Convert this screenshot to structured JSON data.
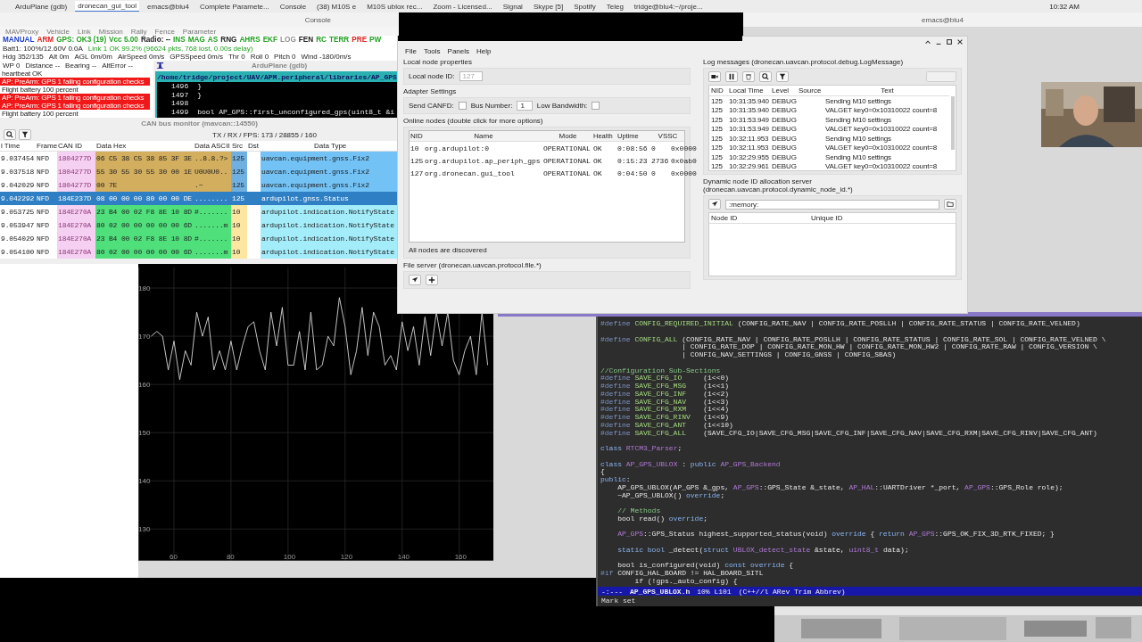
{
  "taskbar": {
    "tasks": [
      {
        "label": "ArduPlane (gdb)",
        "selected": false
      },
      {
        "label": "dronecan_gui_tool",
        "selected": true
      },
      {
        "label": "emacs@blu4",
        "selected": false
      },
      {
        "label": "Complete Paramete...",
        "selected": false
      },
      {
        "label": "Console",
        "selected": false
      },
      {
        "label": "(38) M10S e",
        "selected": false
      },
      {
        "label": "M10S ublox rec...",
        "selected": false
      },
      {
        "label": "Zoom - Licensed...",
        "selected": false
      },
      {
        "label": "Signal",
        "selected": false
      },
      {
        "label": "Skype [5]",
        "selected": false
      },
      {
        "label": "Spotify",
        "selected": false
      },
      {
        "label": "Teleg",
        "selected": false
      },
      {
        "label": "tridge@blu4:~/proje...",
        "selected": false
      }
    ],
    "clock": "10:32 AM"
  },
  "console_title": "Console",
  "emacs_title": "emacs@blu4",
  "mavproxy": {
    "menu": [
      "MAVProxy",
      "Vehicle",
      "Link",
      "Mission",
      "Rally",
      "Fence",
      "Parameter"
    ],
    "status_row": [
      {
        "text": "MANUAL",
        "color": "#1a3cc8"
      },
      {
        "text": "ARM",
        "color": "#e02020"
      },
      {
        "text": "GPS: OK3 (19)",
        "color": "#20a020"
      },
      {
        "text": "Vcc 5.00",
        "color": "#20a020"
      },
      {
        "text": "Radio: --",
        "color": "#202020"
      },
      {
        "text": "INS",
        "color": "#20a020"
      },
      {
        "text": "MAG",
        "color": "#20a020"
      },
      {
        "text": "AS",
        "color": "#20a020"
      },
      {
        "text": "RNG",
        "color": "#202020"
      },
      {
        "text": "AHRS",
        "color": "#20a020"
      },
      {
        "text": "EKF",
        "color": "#20a020"
      },
      {
        "text": "LOG",
        "color": "#909090"
      },
      {
        "text": "FEN",
        "color": "#202020"
      },
      {
        "text": "RC",
        "color": "#20a020"
      },
      {
        "text": "TERR",
        "color": "#20a020"
      },
      {
        "text": "PRE",
        "color": "#e02020"
      },
      {
        "text": "PW",
        "color": "#20a020"
      }
    ],
    "battery": "Batt1: 100%/12.60V 0.0A",
    "link": "Link 1 OK 99.2% (96624 pkts, 768 lost, 0.00s delay)",
    "flight_row": [
      "Hdg 352/135",
      "Alt 0m",
      "AGL 0m/0m",
      "AirSpeed 0m/s",
      "GPSSpeed 0m/s",
      "Thr 0",
      "Roll 0",
      "Pitch 0",
      "Wind -180/0m/s"
    ],
    "nav_row": [
      "WP 0",
      "Distance --",
      "Bearing --",
      "AltError --"
    ],
    "messages": [
      {
        "text": "heartbeat OK",
        "kind": "info"
      },
      {
        "text": "AP: PreArm: GPS 1 failing configuration checks",
        "kind": "error"
      },
      {
        "text": "Flight battery 100 percent",
        "kind": "info"
      },
      {
        "text": "AP: PreArm: GPS 1 failing configuration checks",
        "kind": "error"
      },
      {
        "text": "AP: PreArm: GPS 1 failing configuration checks",
        "kind": "error"
      },
      {
        "text": "Flight battery 100 percent",
        "kind": "info"
      }
    ]
  },
  "gdb": {
    "title": "ArduPlane (gdb)",
    "path": "/home/tridge/project/UAV/APM.peripheral/libraries/AP_GPS",
    "lines": [
      {
        "number": "1496",
        "code": "}"
      },
      {
        "number": "1497",
        "code": "}"
      },
      {
        "number": "1498"
      },
      {
        "number": "1499",
        "code": "bool AP_GPS::first_unconfigured_gps(uint8_t &i"
      }
    ]
  },
  "can_monitor": {
    "title": "CAN bus monitor (mavcan::14550)",
    "stats": "TX / RX / FPS:  173 / 28855 / 160",
    "columns": [
      "l Time",
      "Frame",
      "CAN ID",
      "Data Hex",
      "Data ASCII",
      "Src",
      "Dst",
      "Data Type"
    ],
    "rows": [
      {
        "time": "9.037454",
        "frame": "NFD",
        "can_id": "1804277D",
        "hex": {
          "text": "06 C5 38 C5 38 85 3F 3E",
          "color": "#d2ae5e"
        },
        "ascii": {
          "text": "..8.8.?>",
          "color": "#d2ae5e"
        },
        "src": {
          "text": "125",
          "color": "#6fb0e0"
        },
        "type": {
          "text": "uavcan.equipment.gnss.Fix2",
          "color": "#72c2f5"
        },
        "selected": false
      },
      {
        "time": "9.037518",
        "frame": "NFD",
        "can_id": "1804277D",
        "hex": {
          "text": "55 30 55 30 55 30 00 1E",
          "color": "#d2ae5e"
        },
        "ascii": {
          "text": "U0U0U0..",
          "color": "#d2ae5e"
        },
        "src": {
          "text": "125",
          "color": "#6fb0e0"
        },
        "type": {
          "text": "uavcan.equipment.gnss.Fix2",
          "color": "#72c2f5"
        },
        "selected": false
      },
      {
        "time": "9.042029",
        "frame": "NFD",
        "can_id": "1804277D",
        "hex": {
          "text": "00 7E",
          "color": "#d2ae5e"
        },
        "ascii": {
          "text": ".~",
          "color": "#d2ae5e"
        },
        "src": {
          "text": "125",
          "color": "#6fb0e0"
        },
        "type": {
          "text": "uavcan.equipment.gnss.Fix2",
          "color": "#72c2f5"
        },
        "selected": false
      },
      {
        "time": "9.042292",
        "frame": "NFD",
        "can_id": "184E237D",
        "hex": {
          "text": "08 00 00 00 80 00 00 DE"
        },
        "ascii": {
          "text": "........"
        },
        "src": {
          "text": "125"
        },
        "type": {
          "text": "ardupilot.gnss.Status"
        },
        "selected": true
      },
      {
        "time": "9.053725",
        "frame": "NFD",
        "can_id": "184E270A",
        "hex": {
          "text": "23 B4 00 02 F8 8E 10 8D",
          "color": "#4fe07c"
        },
        "ascii": {
          "text": "#.......",
          "color": "#4fe07c"
        },
        "src": {
          "text": "10",
          "color": "#fde6a0"
        },
        "type": {
          "text": "ardupilot.indication.NotifyState",
          "color": "#a3ecfa"
        },
        "selected": false
      },
      {
        "time": "9.053947",
        "frame": "NFD",
        "can_id": "184E270A",
        "hex": {
          "text": "80 02 00 00 00 00 00 6D",
          "color": "#4fe07c"
        },
        "ascii": {
          "text": ".......m",
          "color": "#4fe07c"
        },
        "src": {
          "text": "10",
          "color": "#fde6a0"
        },
        "type": {
          "text": "ardupilot.indication.NotifyState",
          "color": "#a3ecfa"
        },
        "selected": false
      },
      {
        "time": "9.054029",
        "frame": "NFD",
        "can_id": "184E270A",
        "hex": {
          "text": "23 B4 00 02 F8 8E 10 8D",
          "color": "#4fe07c"
        },
        "ascii": {
          "text": "#.......",
          "color": "#4fe07c"
        },
        "src": {
          "text": "10",
          "color": "#fde6a0"
        },
        "type": {
          "text": "ardupilot.indication.NotifyState",
          "color": "#a3ecfa"
        },
        "selected": false
      },
      {
        "time": "9.054100",
        "frame": "NFD",
        "can_id": "184E270A",
        "hex": {
          "text": "80 02 00 00 00 00 00 6D",
          "color": "#4fe07c"
        },
        "ascii": {
          "text": ".......m",
          "color": "#4fe07c"
        },
        "src": {
          "text": "10",
          "color": "#fde6a0"
        },
        "type": {
          "text": "ardupilot.indication.NotifyState",
          "color": "#a3ecfa"
        },
        "selected": false
      }
    ]
  },
  "plot": {
    "chart_data": {
      "type": "line",
      "grid": true,
      "xlim": [
        47.5,
        172
      ],
      "ylim": [
        123.4,
        185
      ],
      "xticks": [
        60,
        80,
        100,
        120,
        140,
        160
      ],
      "yticks": [
        180,
        170,
        160,
        150,
        140,
        130
      ],
      "x": [
        52,
        54,
        56,
        58,
        60,
        62,
        64,
        66,
        68,
        70,
        72,
        74,
        76,
        78,
        80,
        82,
        84,
        86,
        88,
        90,
        92,
        94,
        96,
        98,
        100,
        102,
        104,
        106,
        108,
        110,
        112,
        114,
        116,
        118,
        120,
        122,
        124,
        126,
        128,
        130,
        132,
        134,
        136,
        138,
        140,
        142,
        144,
        146,
        148,
        150,
        152,
        154,
        156,
        158,
        160,
        162,
        164,
        166,
        168,
        170
      ],
      "series": [
        {
          "color": "#d8d8d8",
          "values": [
            170,
            171,
            170,
            163,
            169,
            161,
            167,
            164,
            175,
            170,
            174,
            163,
            167,
            163,
            169,
            163,
            168,
            172,
            173,
            167,
            163,
            175,
            168,
            176,
            164,
            164,
            171,
            163,
            175,
            163,
            164,
            170,
            168,
            178,
            172,
            162,
            167,
            176,
            166,
            175,
            172,
            164,
            166,
            163,
            173,
            167,
            172,
            164,
            174,
            166,
            175,
            168,
            175,
            165,
            162,
            167,
            170,
            162,
            175,
            164
          ]
        }
      ]
    }
  },
  "gui_tool": {
    "menu": [
      "File",
      "Tools",
      "Panels",
      "Help"
    ],
    "local_node": {
      "heading": "Local node properties",
      "label": "Local node ID:",
      "value": "127"
    },
    "adapter": {
      "heading": "Adapter Settings",
      "canfd_label": "Send CANFD:",
      "canfd": false,
      "bus_label": "Bus Number:",
      "bus": "1",
      "bandwidth_label": "Low Bandwidth:",
      "low_bandwidth": false
    },
    "nodes": {
      "heading": "Online nodes (double click for more options)",
      "columns": [
        "NID",
        "Name",
        "Mode",
        "Health",
        "Uptime",
        "VSSC"
      ],
      "rows": [
        {
          "nid": "10",
          "name": "org.ardupilot:0",
          "mode": "OPERATIONAL",
          "health": "OK",
          "uptime": "0:08:56",
          "vssc": "0",
          "vssc_hex": "0x0000"
        },
        {
          "nid": "125",
          "name": "org.ardupilot.ap_periph_gps",
          "mode": "OPERATIONAL",
          "health": "OK",
          "uptime": "0:15:23",
          "vssc": "2736",
          "vssc_hex": "0x0ab0"
        },
        {
          "nid": "127",
          "name": "org.dronecan.gui_tool",
          "mode": "OPERATIONAL",
          "health": "OK",
          "uptime": "0:04:50",
          "vssc": "0",
          "vssc_hex": "0x0000"
        }
      ],
      "status": "All nodes are discovered"
    },
    "file_server": {
      "heading": "File server (dronecan.uavcan.protocol.file.*)"
    },
    "log": {
      "heading": "Log messages (dronecan.uavcan.protocol.debug.LogMessage)",
      "columns": [
        "NID",
        "Local Time",
        "Level",
        "Source",
        "Text"
      ],
      "rows": [
        {
          "nid": "125",
          "time": "10:31:35.940",
          "level": "DEBUG",
          "text": "Sending M10 settings"
        },
        {
          "nid": "125",
          "time": "10:31:35.940",
          "level": "DEBUG",
          "text": "VALGET key0=0x10310022 count=8"
        },
        {
          "nid": "125",
          "time": "10:31:53.949",
          "level": "DEBUG",
          "text": "Sending M10 settings"
        },
        {
          "nid": "125",
          "time": "10:31:53.949",
          "level": "DEBUG",
          "text": "VALGET key0=0x10310022 count=8"
        },
        {
          "nid": "125",
          "time": "10:32:11.953",
          "level": "DEBUG",
          "text": "Sending M10 settings"
        },
        {
          "nid": "125",
          "time": "10:32:11.953",
          "level": "DEBUG",
          "text": "VALGET key0=0x10310022 count=8"
        },
        {
          "nid": "125",
          "time": "10:32:29.955",
          "level": "DEBUG",
          "text": "Sending M10 settings"
        },
        {
          "nid": "125",
          "time": "10:32:29.961",
          "level": "DEBUG",
          "text": "VALGET key0=0x10310022 count=8"
        }
      ]
    },
    "allocator": {
      "heading": "Dynamic node ID allocation server (dronecan.uavcan.protocol.dynamic_node_id.*)",
      "database": ":memory:",
      "columns": [
        "Node ID",
        "Unique ID"
      ]
    }
  },
  "emacs": {
    "blocks": [
      {
        "lines": [
          {
            "segments": [
              {
                "text": "#define",
                "kind": "pre"
              },
              {
                "text": " CONFIG_REQUIRED_INITIAL",
                "kind": "macro"
              },
              {
                "text": " (CONFIG_RATE_NAV | CONFIG_RATE_POSLLH | CONFIG_RATE_STATUS | CONFIG_RATE_VELNED)",
                "kind": "plain"
              }
            ]
          }
        ]
      },
      {
        "lines": [
          {
            "segments": [
              {
                "text": "#define",
                "kind": "pre"
              },
              {
                "text": " CONFIG_ALL",
                "kind": "macro"
              },
              {
                "text": " (CONFIG_RATE_NAV | CONFIG_RATE_POSLLH | CONFIG_RATE_STATUS | CONFIG_RATE_SOL | CONFIG_RATE_VELNED \\",
                "kind": "plain"
              }
            ]
          },
          {
            "segments": [
              {
                "text": "                   | CONFIG_RATE_DOP | CONFIG_RATE_MON_HW | CONFIG_RATE_MON_HW2 | CONFIG_RATE_RAW | CONFIG_VERSION \\",
                "kind": "plain"
              }
            ]
          },
          {
            "segments": [
              {
                "text": "                   | CONFIG_NAV_SETTINGS | CONFIG_GNSS | CONFIG_SBAS)",
                "kind": "plain"
              }
            ]
          }
        ]
      },
      {
        "lines": [
          {
            "segments": [
              {
                "text": "//Configuration Sub-Sections",
                "kind": "comment"
              }
            ]
          },
          {
            "segments": [
              {
                "text": "#define",
                "kind": "pre"
              },
              {
                "text": " SAVE_CFG_IO",
                "kind": "macro"
              },
              {
                "text": "     (1<<0)",
                "kind": "plain"
              }
            ]
          },
          {
            "segments": [
              {
                "text": "#define",
                "kind": "pre"
              },
              {
                "text": " SAVE_CFG_MSG",
                "kind": "macro"
              },
              {
                "text": "    (1<<1)",
                "kind": "plain"
              }
            ]
          },
          {
            "segments": [
              {
                "text": "#define",
                "kind": "pre"
              },
              {
                "text": " SAVE_CFG_INF",
                "kind": "macro"
              },
              {
                "text": "    (1<<2)",
                "kind": "plain"
              }
            ]
          },
          {
            "segments": [
              {
                "text": "#define",
                "kind": "pre"
              },
              {
                "text": " SAVE_CFG_NAV",
                "kind": "macro"
              },
              {
                "text": "    (1<<3)",
                "kind": "plain"
              }
            ]
          },
          {
            "segments": [
              {
                "text": "#define",
                "kind": "pre"
              },
              {
                "text": " SAVE_CFG_RXM",
                "kind": "macro"
              },
              {
                "text": "    (1<<4)",
                "kind": "plain"
              }
            ]
          },
          {
            "segments": [
              {
                "text": "#define",
                "kind": "pre"
              },
              {
                "text": " SAVE_CFG_RINV",
                "kind": "macro"
              },
              {
                "text": "   (1<<9)",
                "kind": "plain"
              }
            ]
          },
          {
            "segments": [
              {
                "text": "#define",
                "kind": "pre"
              },
              {
                "text": " SAVE_CFG_ANT",
                "kind": "macro"
              },
              {
                "text": "    (1<<10)",
                "kind": "plain"
              }
            ]
          },
          {
            "segments": [
              {
                "text": "#define",
                "kind": "pre"
              },
              {
                "text": " SAVE_CFG_ALL",
                "kind": "macro"
              },
              {
                "text": "    (SAVE_CFG_IO|SAVE_CFG_MSG|SAVE_CFG_INF|SAVE_CFG_NAV|SAVE_CFG_RXM|SAVE_CFG_RINV|SAVE_CFG_ANT)",
                "kind": "plain"
              }
            ]
          }
        ]
      },
      {
        "lines": [
          {
            "segments": [
              {
                "text": "class",
                "kind": "keyword"
              },
              {
                "text": " RTCM3_Parser",
                "kind": "type"
              },
              {
                "text": ";",
                "kind": "plain"
              }
            ]
          }
        ]
      },
      {
        "lines": [
          {
            "segments": [
              {
                "text": "class",
                "kind": "keyword"
              },
              {
                "text": " AP_GPS_UBLOX",
                "kind": "type"
              },
              {
                "text": " : ",
                "kind": "plain"
              },
              {
                "text": "public",
                "kind": "keyword"
              },
              {
                "text": " AP_GPS_Backend",
                "kind": "type"
              }
            ]
          },
          {
            "segments": [
              {
                "text": "{",
                "kind": "plain"
              }
            ]
          },
          {
            "segments": [
              {
                "text": "public",
                "kind": "keyword"
              },
              {
                "text": ":",
                "kind": "plain"
              }
            ]
          },
          {
            "segments": [
              {
                "text": "    AP_GPS_UBLOX(AP_GPS &_gps, ",
                "kind": "plain"
              },
              {
                "text": "AP_GPS",
                "kind": "type"
              },
              {
                "text": "::GPS_State &_state, ",
                "kind": "plain"
              },
              {
                "text": "AP_HAL",
                "kind": "type"
              },
              {
                "text": "::UARTDriver *_port, ",
                "kind": "plain"
              },
              {
                "text": "AP_GPS",
                "kind": "type"
              },
              {
                "text": "::GPS_Role role);",
                "kind": "plain"
              }
            ]
          },
          {
            "segments": [
              {
                "text": "    ~AP_GPS_UBLOX() ",
                "kind": "plain"
              },
              {
                "text": "override",
                "kind": "keyword"
              },
              {
                "text": ";",
                "kind": "plain"
              }
            ]
          }
        ]
      },
      {
        "lines": [
          {
            "segments": [
              {
                "text": "    // Methods",
                "kind": "comment"
              }
            ]
          },
          {
            "segments": [
              {
                "text": "    bool read() ",
                "kind": "plain"
              },
              {
                "text": "override",
                "kind": "keyword"
              },
              {
                "text": ";",
                "kind": "plain"
              }
            ]
          }
        ]
      },
      {
        "lines": [
          {
            "segments": [
              {
                "text": "    AP_GPS",
                "kind": "type"
              },
              {
                "text": "::GPS_Status highest_supported_status(void) ",
                "kind": "plain"
              },
              {
                "text": "override",
                "kind": "keyword"
              },
              {
                "text": " { ",
                "kind": "plain"
              },
              {
                "text": "return",
                "kind": "keyword"
              },
              {
                "text": " AP_GPS",
                "kind": "type"
              },
              {
                "text": "::GPS_OK_FIX_3D_RTK_FIXED; }",
                "kind": "plain"
              }
            ]
          }
        ]
      },
      {
        "lines": [
          {
            "segments": [
              {
                "text": "    static bool",
                "kind": "keyword"
              },
              {
                "text": " _detect(",
                "kind": "plain"
              },
              {
                "text": "struct",
                "kind": "keyword"
              },
              {
                "text": " UBLOX_detect_state",
                "kind": "type"
              },
              {
                "text": " &state, ",
                "kind": "plain"
              },
              {
                "text": "uint8_t",
                "kind": "type"
              },
              {
                "text": " data);",
                "kind": "plain"
              }
            ]
          }
        ]
      },
      {
        "lines": [
          {
            "segments": [
              {
                "text": "    bool is_configured(void) ",
                "kind": "plain"
              },
              {
                "text": "const override",
                "kind": "keyword"
              },
              {
                "text": " {",
                "kind": "plain"
              }
            ]
          },
          {
            "segments": [
              {
                "text": "#if",
                "kind": "pre"
              },
              {
                "text": " CONFIG_HAL_BOARD != HAL_BOARD_SITL",
                "kind": "plain"
              }
            ]
          },
          {
            "segments": [
              {
                "text": "        if (!gps._auto_config) {",
                "kind": "plain"
              }
            ]
          }
        ]
      }
    ],
    "modeline": {
      "state": "-:---",
      "file": "AP_GPS_UBLOX.h",
      "position": "10% L101",
      "modes": "(C++//l ARev Trim Abbrev)"
    },
    "echo": "Mark set"
  }
}
